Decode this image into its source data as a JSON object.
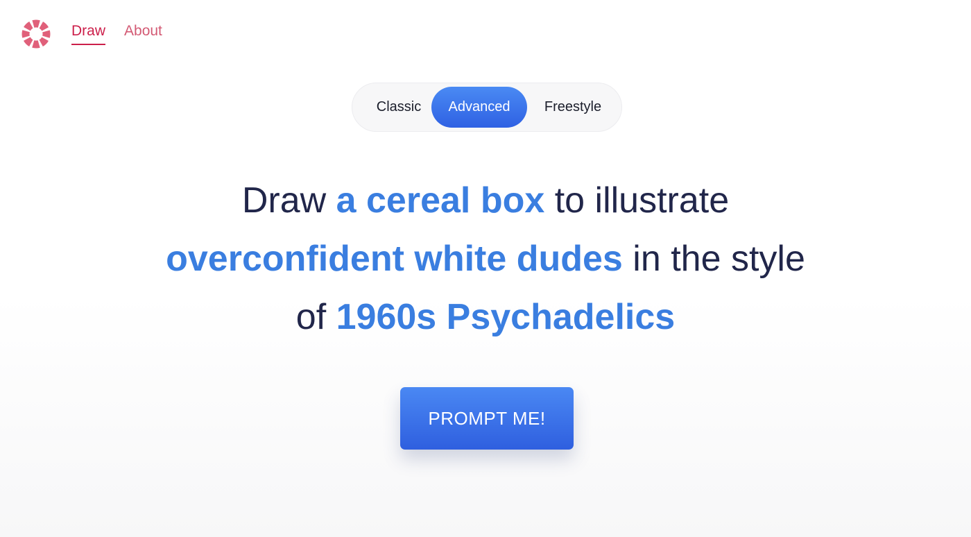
{
  "nav": {
    "items": [
      {
        "label": "Draw",
        "active": true
      },
      {
        "label": "About",
        "active": false
      }
    ]
  },
  "logo": {
    "icon": "lifebuoy-icon",
    "color": "#e0607a"
  },
  "modes": {
    "options": [
      "Classic",
      "Advanced",
      "Freestyle"
    ],
    "selected": "Advanced"
  },
  "prompt": {
    "parts": [
      {
        "text": "Draw ",
        "highlight": false
      },
      {
        "text": "a cereal box",
        "highlight": true
      },
      {
        "text": " to illustrate",
        "highlight": false
      },
      {
        "text": "overconfident white dudes",
        "highlight": true
      },
      {
        "text": " in the style",
        "highlight": false
      },
      {
        "text": "of ",
        "highlight": false
      },
      {
        "text": "1960s Psychadelics",
        "highlight": true
      }
    ]
  },
  "cta": {
    "label": "PROMPT ME!"
  },
  "colors": {
    "accent": "#3a7ee0",
    "brand": "#cc1f4a",
    "text": "#21264a"
  }
}
